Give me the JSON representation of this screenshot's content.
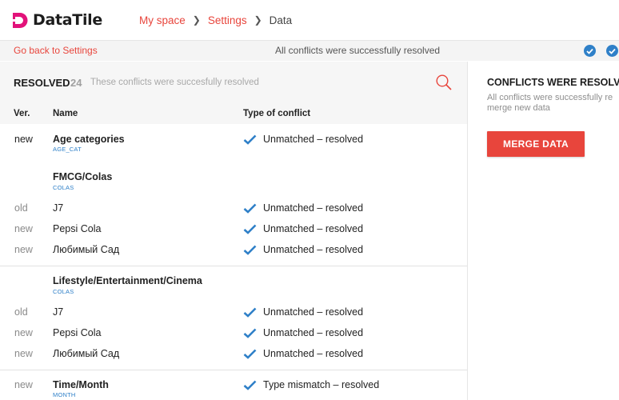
{
  "app": {
    "logo_text": "DataTile"
  },
  "breadcrumb": {
    "items": [
      "My space",
      "Settings"
    ],
    "current": "Data"
  },
  "subbar": {
    "back_link": "Go back to Settings",
    "status": "All conflicts were successfully resolved"
  },
  "resolved": {
    "title": "RESOLVED",
    "count": "24",
    "description": "These conflicts were succesfully resolved",
    "columns": {
      "ver": "Ver.",
      "name": "Name",
      "type": "Type of conflict"
    },
    "rows": [
      {
        "ver": "new",
        "name": "Age categories",
        "code": "AGE_CAT",
        "type": "Unmatched – resolved"
      },
      {
        "group": "FMCG/Colas",
        "code": "COLAS"
      },
      {
        "ver": "old",
        "name": "J7",
        "type": "Unmatched – resolved"
      },
      {
        "ver": "new",
        "name": "Pepsi Cola",
        "type": "Unmatched – resolved"
      },
      {
        "ver": "new",
        "name": "Любимый Сад",
        "type": "Unmatched – resolved"
      },
      {
        "group": "Lifestyle/Entertainment/Cinema",
        "code": "COLAS"
      },
      {
        "ver": "old",
        "name": "J7",
        "type": "Unmatched – resolved"
      },
      {
        "ver": "new",
        "name": "Pepsi Cola",
        "type": "Unmatched – resolved"
      },
      {
        "ver": "new",
        "name": "Любимый Сад",
        "type": "Unmatched – resolved"
      },
      {
        "ver": "new",
        "name": "Time/Month",
        "code": "MONTH",
        "type": "Type mismatch – resolved"
      }
    ]
  },
  "right_panel": {
    "title": "CONFLICTS WERE RESOLVE",
    "description_line1": "All conflicts were successfully re",
    "description_line2": "merge new data",
    "merge_button": "MERGE DATA"
  },
  "colors": {
    "accent": "#e8453c",
    "blue": "#2f80c8"
  }
}
